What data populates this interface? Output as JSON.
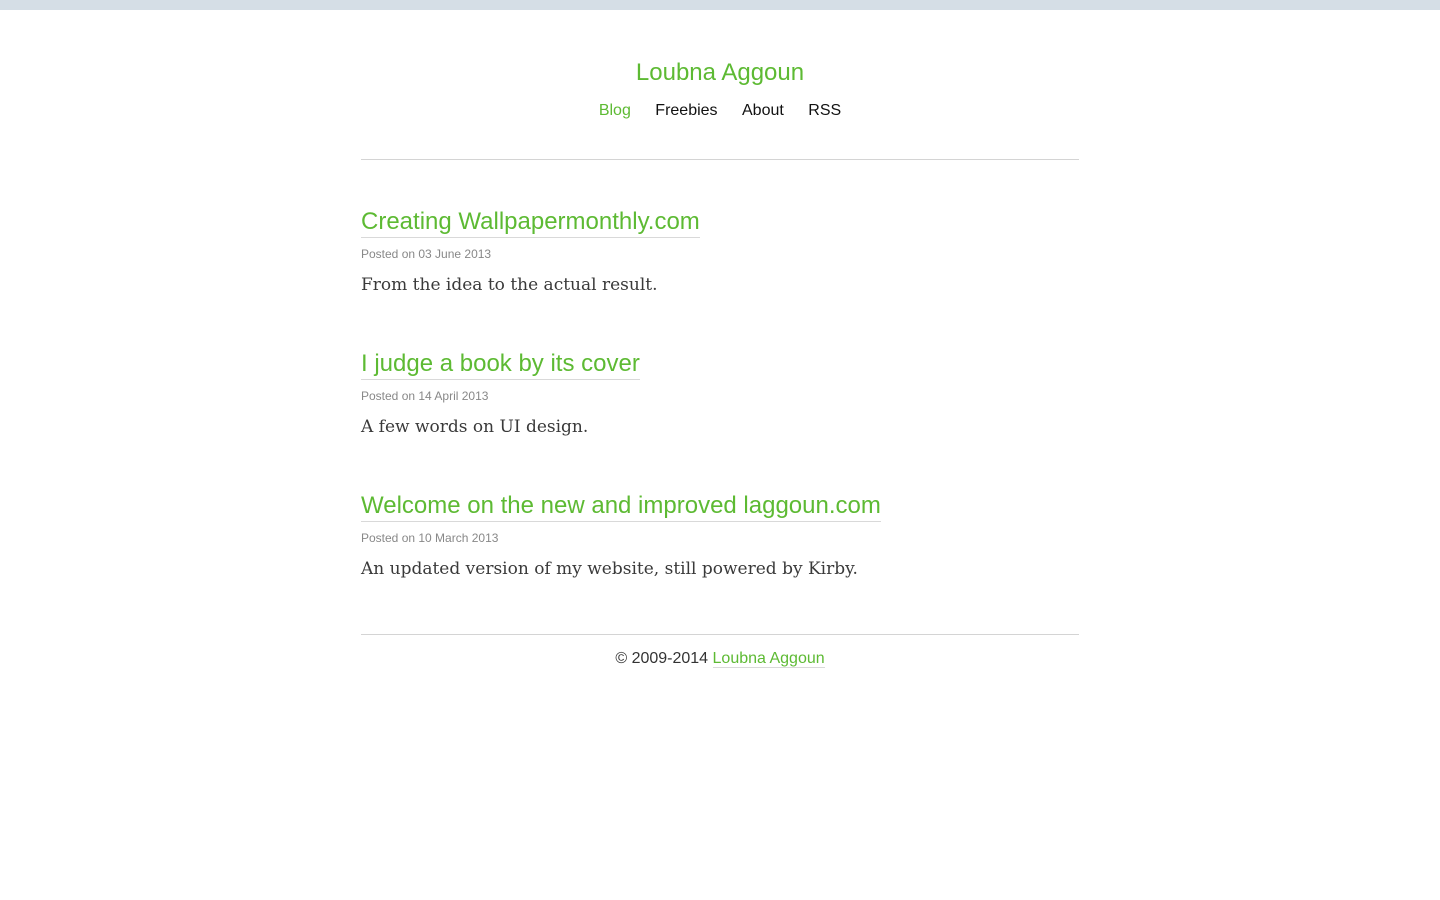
{
  "site": {
    "title": "Loubna Aggoun"
  },
  "nav": {
    "items": [
      {
        "label": "Blog",
        "active": true
      },
      {
        "label": "Freebies",
        "active": false
      },
      {
        "label": "About",
        "active": false
      },
      {
        "label": "RSS",
        "active": false
      }
    ]
  },
  "posts": [
    {
      "title": "Creating Wallpapermonthly.com",
      "meta": "Posted on 03 June 2013",
      "excerpt": "From the idea to the actual result."
    },
    {
      "title": "I judge a book by its cover",
      "meta": "Posted on 14 April 2013",
      "excerpt": "A few words on UI design."
    },
    {
      "title": "Welcome on the new and improved laggoun.com",
      "meta": "Posted on 10 March 2013",
      "excerpt": "An updated version of my website, still powered by Kirby."
    }
  ],
  "footer": {
    "copyright": "© 2009-2014",
    "author_link": "Loubna Aggoun"
  },
  "colors": {
    "accent": "#5dba33",
    "topbar": "#d5dee6"
  }
}
